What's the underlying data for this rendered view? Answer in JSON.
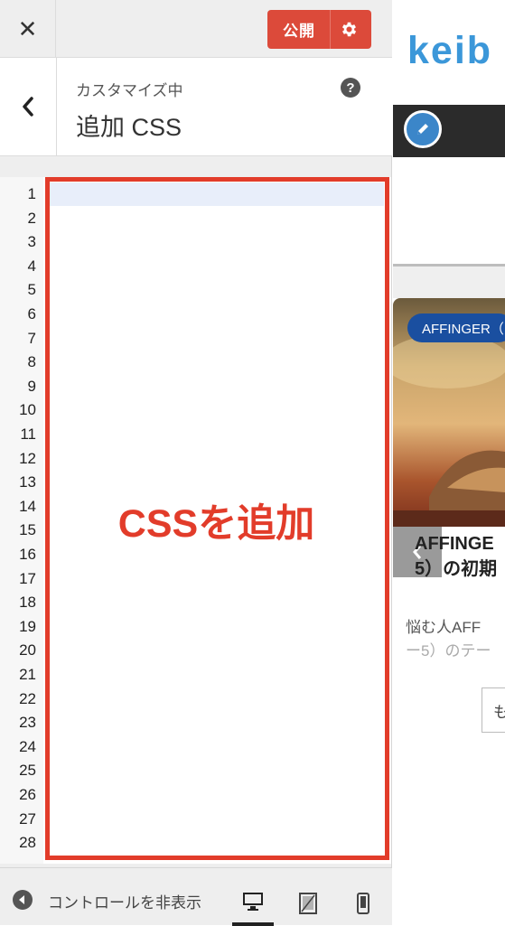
{
  "header": {
    "close_icon": "close-icon",
    "publish_label": "公開",
    "settings_icon": "gear-icon"
  },
  "section": {
    "subtitle": "カスタマイズ中",
    "title": "追加 CSS",
    "help_label": "?"
  },
  "editor": {
    "line_numbers": [
      "1",
      "2",
      "3",
      "4",
      "5",
      "6",
      "7",
      "8",
      "9",
      "10",
      "11",
      "12",
      "13",
      "14",
      "15",
      "16",
      "17",
      "18",
      "19",
      "20",
      "21",
      "22",
      "23",
      "24",
      "25",
      "26",
      "27",
      "28"
    ],
    "content": "",
    "annotation": "CSSを追加",
    "annotation_color": "#e23c2a"
  },
  "footer": {
    "collapse_label": "コントロールを非表示",
    "devices": [
      "desktop-icon",
      "tablet-icon",
      "mobile-icon"
    ],
    "active_device": "desktop"
  },
  "preview": {
    "logo": "keib",
    "card": {
      "tag": "AFFINGER（",
      "title_line1": "AFFINGE",
      "title_line2": "5）の初期",
      "excerpt_line1": "悩む人AFF",
      "excerpt_line2": "ー5）のテー",
      "more_label": "も"
    }
  },
  "colors": {
    "accent": "#dc4a3a",
    "brand_blue": "#3b97d9",
    "tag_blue": "#1a4fa0"
  }
}
